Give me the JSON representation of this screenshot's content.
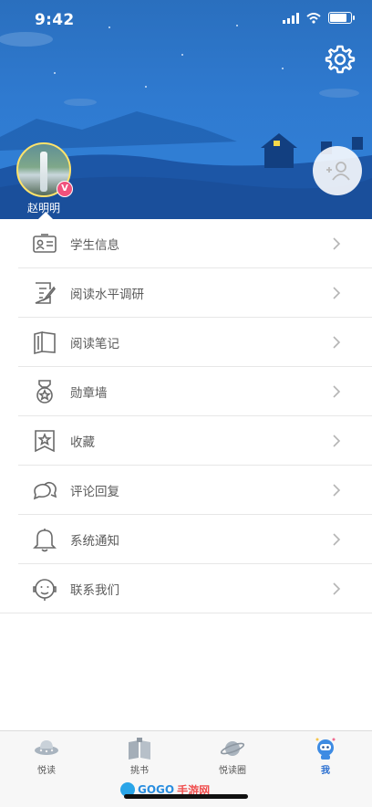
{
  "status_bar": {
    "time": "9:42"
  },
  "profile": {
    "username": "赵明明",
    "badge": "V"
  },
  "menu": {
    "items": [
      {
        "label": "学生信息",
        "icon": "id-card-icon"
      },
      {
        "label": "阅读水平调研",
        "icon": "survey-edit-icon"
      },
      {
        "label": "阅读笔记",
        "icon": "open-book-icon"
      },
      {
        "label": "勋章墙",
        "icon": "medal-icon"
      },
      {
        "label": "收藏",
        "icon": "bookmark-star-icon"
      },
      {
        "label": "评论回复",
        "icon": "chat-bubbles-icon"
      },
      {
        "label": "系统通知",
        "icon": "bell-icon"
      },
      {
        "label": "联系我们",
        "icon": "customer-service-icon"
      }
    ]
  },
  "tabbar": {
    "tabs": [
      {
        "label": "悦读",
        "icon": "ufo-icon",
        "active": false
      },
      {
        "label": "挑书",
        "icon": "book-icon",
        "active": false
      },
      {
        "label": "悦读圈",
        "icon": "planet-icon",
        "active": false
      },
      {
        "label": "我",
        "icon": "astronaut-icon",
        "active": true
      }
    ]
  },
  "watermark": {
    "part1": "GOGO",
    "part2": "手游网"
  },
  "colors": {
    "header_blue": "#2f7ad0",
    "active_tab": "#2a6fd0",
    "badge_pink": "#f0527c"
  }
}
